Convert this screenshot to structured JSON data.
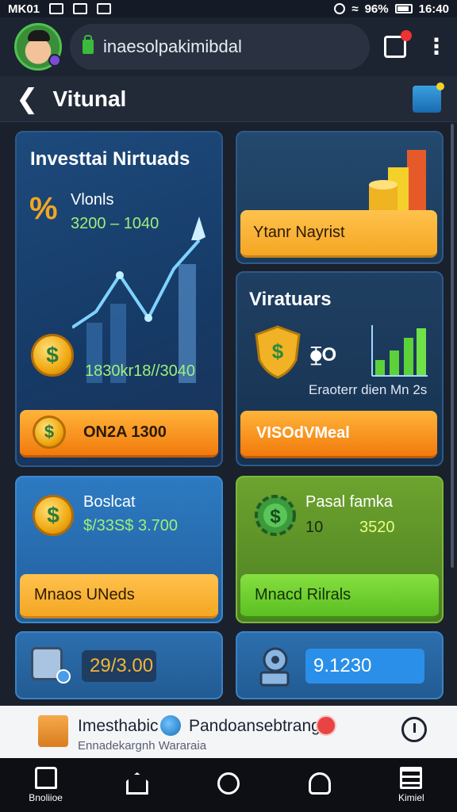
{
  "status_bar": {
    "carrier": "MK01",
    "battery": "96%",
    "time": "16:40"
  },
  "browser": {
    "url": "inaesolpakimibdal"
  },
  "header": {
    "title": "Vitunal"
  },
  "cards": {
    "investment": {
      "title": "Investtai Nirtuads",
      "label": "Vlonls",
      "range": "3200 – 1040",
      "stat": "1830kr18//3040",
      "button": "ON2A 1300"
    },
    "coins": {
      "button": "Ytanr Nayrist"
    },
    "virtuals": {
      "title": "Viratuars",
      "ratio": "⧳O",
      "caption": "Eraoterr dien Mn 2s",
      "button": "VISOdVMeal"
    },
    "boslcat": {
      "title": "Boslcat",
      "value": "$/33S$ 3.700",
      "button": "Mnaos UNeds"
    },
    "pasal": {
      "title": "Pasal famka",
      "left_value": "10",
      "right_value": "3520",
      "button": "Mnacd Rilrals"
    },
    "small_left": {
      "value": "29/3.00"
    },
    "small_right": {
      "value": "9.1230"
    }
  },
  "info_bar": {
    "title": "Imesthabic",
    "subtitle": "Pandoansebtranga",
    "caption": "Ennadekargnh Wararaia"
  },
  "nav": {
    "items": [
      {
        "label": "Bnoliioe"
      },
      {
        "label": ""
      },
      {
        "label": ""
      },
      {
        "label": ""
      },
      {
        "label": "Kimiel"
      }
    ]
  },
  "colors": {
    "accent_orange": "#f27a0d",
    "accent_green": "#5cbf22",
    "card_blue": "#1d4a7c"
  }
}
